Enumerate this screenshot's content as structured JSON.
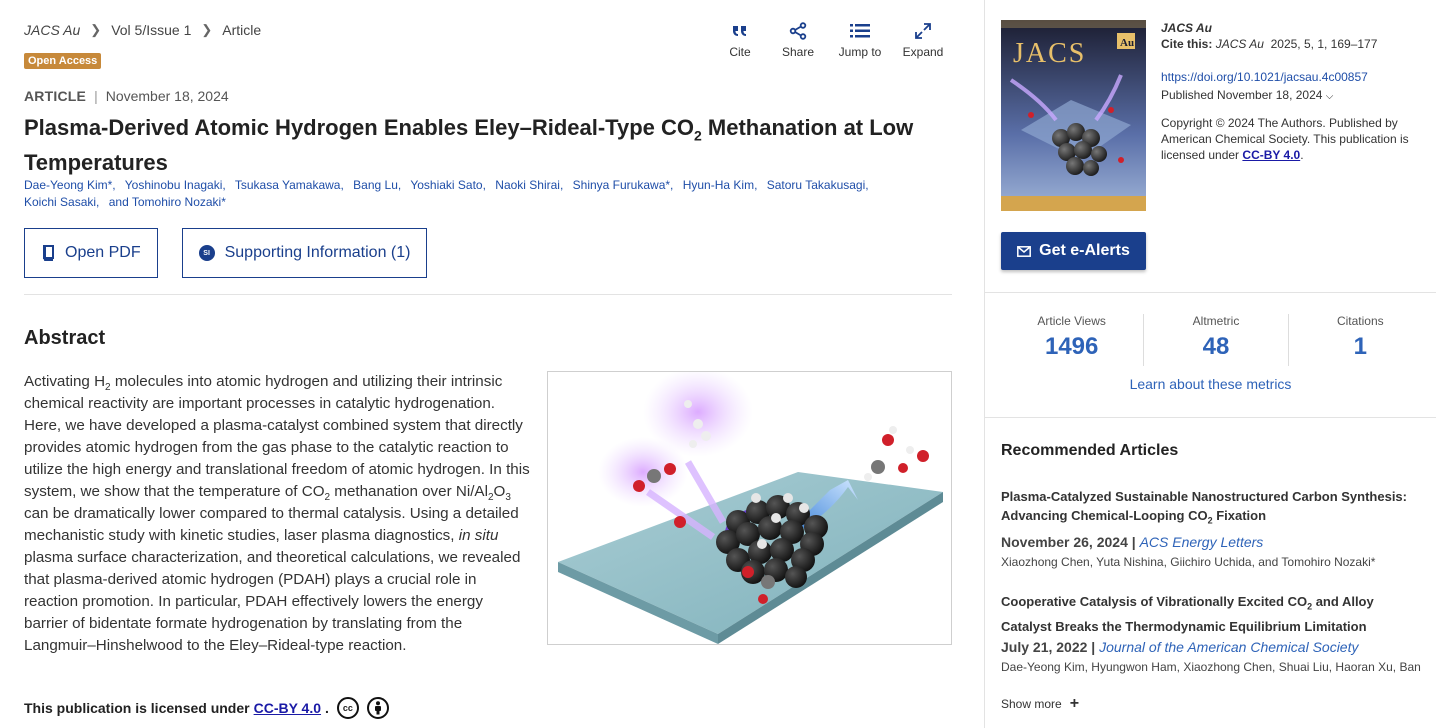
{
  "breadcrumb": {
    "journal": "JACS Au",
    "volume": "Vol 5/Issue 1",
    "section": "Article"
  },
  "badge": "Open Access",
  "toolbar": {
    "cite": "Cite",
    "share": "Share",
    "jump": "Jump to",
    "expand": "Expand"
  },
  "article": {
    "type": "ARTICLE",
    "date": "November 18, 2024",
    "title_pre": "Plasma-Derived Atomic Hydrogen Enables Eley–Rideal-Type CO",
    "title_sub": "2",
    "title_post": " Methanation at Low Temperatures",
    "authors": [
      "Dae-Yeong Kim*,",
      "Yoshinobu Inagaki,",
      "Tsukasa Yamakawa,",
      "Bang Lu,",
      "Yoshiaki Sato,",
      "Naoki Shirai,",
      "Shinya Furukawa*,",
      "Hyun-Ha Kim,",
      "Satoru Takakusagi,",
      "Koichi Sasaki,",
      "and Tomohiro Nozaki*"
    ]
  },
  "buttons": {
    "pdf": "Open PDF",
    "si": "Supporting Information (1)",
    "si_icon": "SI"
  },
  "abstract": {
    "heading": "Abstract",
    "p1": "Activating H",
    "p1s": "2",
    "p2": " molecules into atomic hydrogen and utilizing their intrinsic chemical reactivity are important processes in catalytic hydrogenation. Here, we have developed a plasma-catalyst combined system that directly provides atomic hydrogen from the gas phase to the catalytic reaction to utilize the high energy and translational freedom of atomic hydrogen. In this system, we show that the temperature of CO",
    "p2s": "2",
    "p3": " methanation over Ni/Al",
    "p3s": "2",
    "p4": "O",
    "p4s": "3",
    "p5": " can be dramatically lower compared to thermal catalysis. Using a detailed mechanistic study with kinetic studies, laser plasma diagnostics, ",
    "p5i": "in situ",
    "p6": " plasma surface characterization, and theoretical calculations, we revealed that plasma-derived atomic hydrogen (PDAH) plays a crucial role in reaction promotion. In particular, PDAH effectively lowers the energy barrier of bidentate formate hydrogenation by translating from the Langmuir–Hinshelwood to the Eley–Rideal-type reaction."
  },
  "license": {
    "text": "This publication is licensed under",
    "link": "CC-BY 4.0",
    "dot": ".",
    "cc_icon": "cc"
  },
  "side": {
    "journal": "JACS Au",
    "cite_label": "Cite this:",
    "cite_journal": "JACS Au",
    "cite_ref": "2025, 5, 1, 169–177",
    "doi": "https://doi.org/10.1021/jacsau.4c00857",
    "published": "Published November 18, 2024",
    "copyright": "Copyright © 2024 The Authors. Published by American Chemical Society. This publication is licensed under",
    "copyright_link": "CC-BY 4.0",
    "copyright_end": ".",
    "cover_text": "JACS",
    "cover_badge": "Au",
    "alerts": "Get e-Alerts"
  },
  "metrics": [
    {
      "label": "Article Views",
      "value": "1496"
    },
    {
      "label": "Altmetric",
      "value": "48"
    },
    {
      "label": "Citations",
      "value": "1"
    }
  ],
  "learn_more": "Learn about these metrics",
  "recommended": {
    "heading": "Recommended Articles",
    "items": [
      {
        "title_a": "Plasma-Catalyzed Sustainable Nanostructured Carbon Synthesis: Advancing Chemical-Looping CO",
        "title_s": "2",
        "title_b": " Fixation",
        "date": "November 26, 2024",
        "journal": "ACS Energy Letters",
        "authors": "Xiaozhong Chen, Yuta Nishina, Giichiro Uchida, and Tomohiro Nozaki*"
      },
      {
        "title_a": "Cooperative Catalysis of Vibrationally Excited CO",
        "title_s": "2",
        "title_b": " and Alloy Catalyst Breaks the Thermodynamic Equilibrium Limitation",
        "date": "July 21, 2022",
        "journal": "Journal of the American Chemical Society",
        "authors": "Dae-Yeong Kim, Hyungwon Ham, Xiaozhong Chen, Shuai Liu, Haoran Xu, Ban..."
      }
    ],
    "show_more": "Show more",
    "show_more_icon": "+"
  },
  "colors": {
    "accent": "#1a3f8c",
    "link": "#2e63b8",
    "badge": "#c7893a"
  }
}
